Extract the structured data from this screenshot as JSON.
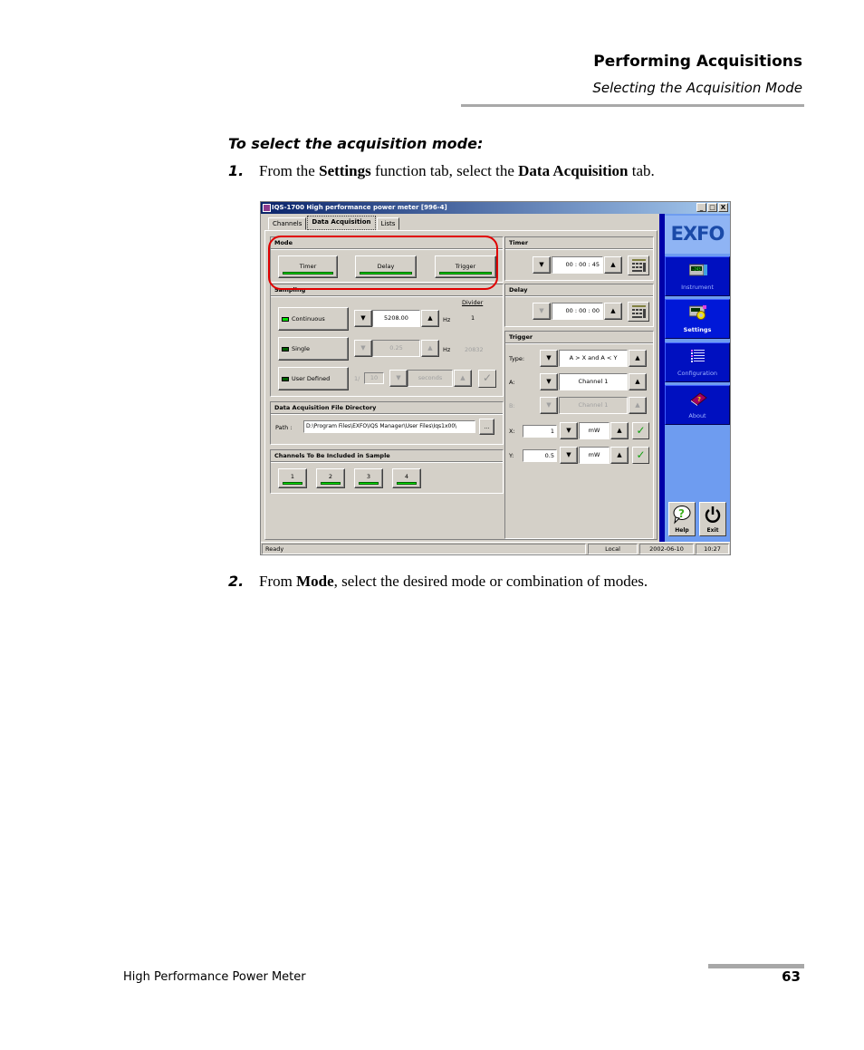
{
  "header": {
    "chapter": "Performing Acquisitions",
    "section": "Selecting the Acquisition Mode"
  },
  "procedure": {
    "title": "To select the acquisition mode:",
    "steps": [
      {
        "number": "1.",
        "pre": "From the ",
        "bold1": "Settings",
        "mid": " function tab, select the ",
        "bold2": "Data Acquisition",
        "post": " tab."
      },
      {
        "number": "2.",
        "pre": "From ",
        "bold1": "Mode",
        "post": ", select the desired mode or combination of modes."
      }
    ]
  },
  "footer": {
    "doc_title": "High Performance Power Meter",
    "page_number": "63"
  },
  "app": {
    "title": "IQS-1700 High performance power meter [996-4]",
    "window_buttons": [
      "_",
      "□",
      "X"
    ],
    "tabs": [
      {
        "label": "Channels",
        "active": false
      },
      {
        "label": "Data Acquisition",
        "active": true
      },
      {
        "label": "Lists",
        "active": false
      }
    ],
    "mode": {
      "heading": "Mode",
      "buttons": [
        {
          "label": "Timer",
          "on": true
        },
        {
          "label": "Delay",
          "on": true
        },
        {
          "label": "Trigger",
          "on": true
        }
      ]
    },
    "sampling": {
      "heading": "Sampling",
      "divider_header": "Divider",
      "continuous": {
        "label": "Continuous",
        "on": true,
        "value": "5208.00",
        "unit": "Hz",
        "divider": "1"
      },
      "single": {
        "label": "Single",
        "on": false,
        "value": "0.25",
        "unit": "Hz",
        "divider": "20832"
      },
      "user_defined": {
        "label": "User Defined",
        "on": false,
        "prefix": "1/",
        "value": "10",
        "unit": "seconds"
      }
    },
    "file_directory": {
      "heading": "Data Acquisition File Directory",
      "path_label": "Path :",
      "path_value": "D:\\Program Files\\EXFO\\IQS Manager\\User Files\\Iqs1x00\\",
      "browse_label": "..."
    },
    "channels": {
      "heading": "Channels To Be Included in Sample",
      "buttons": [
        "1",
        "2",
        "3",
        "4"
      ]
    },
    "timer": {
      "heading": "Timer",
      "value": "00 : 00 : 45"
    },
    "delay": {
      "heading": "Delay",
      "value": "00 : 00 : 00"
    },
    "trigger": {
      "heading": "Trigger",
      "type_label": "Type:",
      "type_value": "A > X and A < Y",
      "a_label": "A:",
      "a_value": "Channel 1",
      "b_label": "B:",
      "b_value": "Channel 1",
      "x_label": "X:",
      "x_value": "1",
      "x_unit": "mW",
      "y_label": "Y:",
      "y_value": "0.5",
      "y_unit": "mW"
    },
    "sidebar": {
      "logo": "EXFO",
      "items": [
        {
          "label": "Instrument",
          "active": false
        },
        {
          "label": "Settings",
          "active": true
        },
        {
          "label": "Configuration",
          "active": false
        },
        {
          "label": "About",
          "active": false
        }
      ],
      "help_label": "Help",
      "exit_label": "Exit"
    },
    "status": {
      "message": "Ready",
      "mode": "Local",
      "date": "2002-06-10",
      "time": "10:27"
    }
  }
}
